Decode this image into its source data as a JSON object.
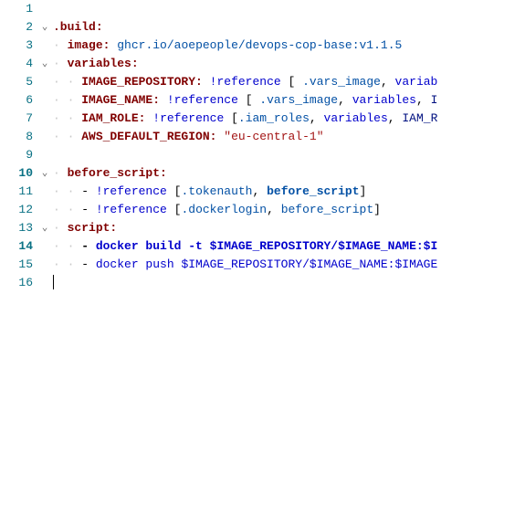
{
  "lines": {
    "l1": "",
    "l2_key": ".build",
    "l3_key": "image",
    "l3_val": "ghcr.io/aoepeople/devops-cop-base:v1.1.5",
    "l4_key": "variables",
    "l5_key": "IMAGE_REPOSITORY",
    "l5_tag": "!reference",
    "l5_ref": ".vars_image",
    "l5_word": "variab",
    "l6_key": "IMAGE_NAME",
    "l6_tag": "!reference",
    "l6_ref": ".vars_image",
    "l6_word": "variables",
    "l6_tail": "I",
    "l7_key": "IAM_ROLE",
    "l7_tag": "!reference",
    "l7_ref": ".iam_roles",
    "l7_word": "variables",
    "l7_tail": "IAM_R",
    "l8_key": "AWS_DEFAULT_REGION",
    "l8_val": "\"eu-central-1\"",
    "l10_key": "before_script",
    "l11_tag": "!reference",
    "l11_ref": ".tokenauth",
    "l11_word": "before_script",
    "l12_tag": "!reference",
    "l12_ref": ".dockerlogin",
    "l12_word": "before_script",
    "l13_key": "script",
    "l14": "docker build -t $IMAGE_REPOSITORY/$IMAGE_NAME:$I",
    "l15": "docker push $IMAGE_REPOSITORY/$IMAGE_NAME:$IMAGE"
  },
  "gutter": [
    "1",
    "2",
    "3",
    "4",
    "5",
    "6",
    "7",
    "8",
    "9",
    "10",
    "11",
    "12",
    "13",
    "14",
    "15",
    "16"
  ],
  "fold_chevron": "⌄"
}
